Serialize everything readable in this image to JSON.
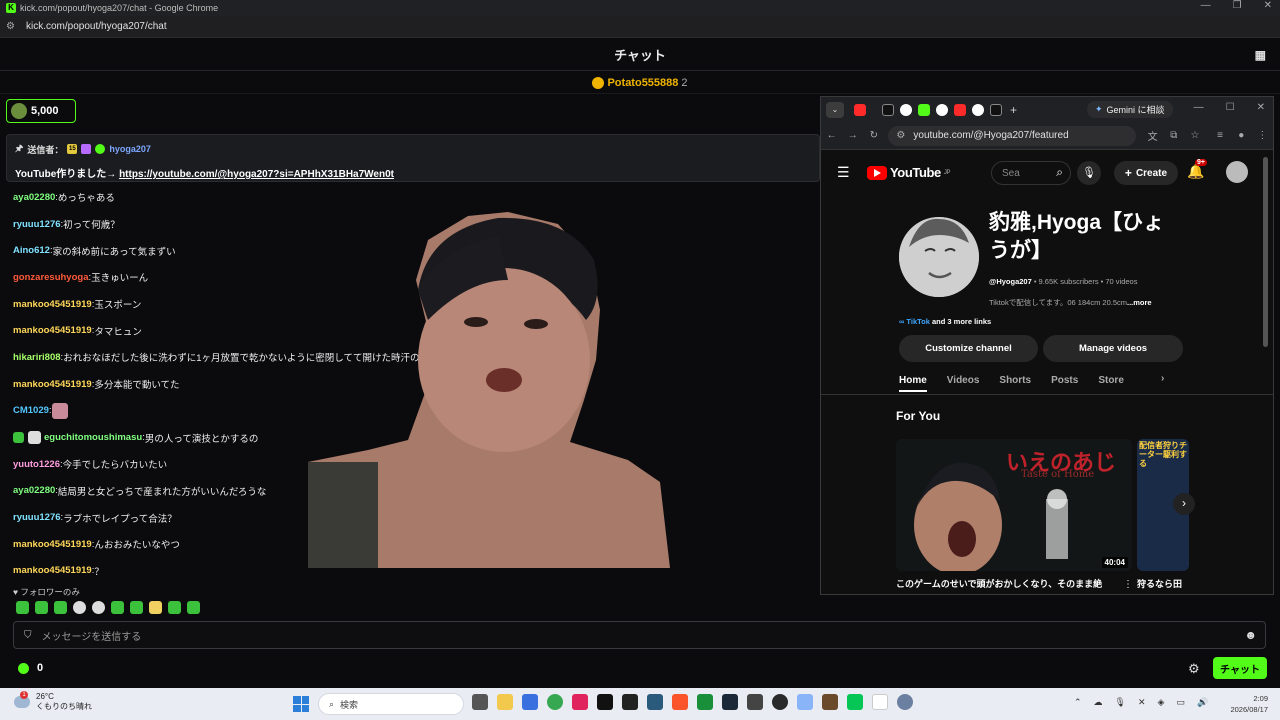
{
  "window": {
    "title": "kick.com/popout/hyoga207/chat - Google Chrome",
    "url": "kick.com/popout/hyoga207/chat"
  },
  "chat": {
    "header": "チャット",
    "gift_user": "Potato555888",
    "gift_count": "2",
    "kicks_balance": "5,000",
    "pinned": {
      "label": "送信者：",
      "badge_sub": "15",
      "user": "hyoga207",
      "message_prefix": "YouTube作りました→ ",
      "link": "https://youtube.com/@hyoga207?si=APHhX31BHa7Wen0t"
    },
    "messages": [
      {
        "user": "aya02280",
        "color": "#80ff80",
        "text": "めっちゃある"
      },
      {
        "user": "ryuuu1276",
        "color": "#7fe3ff",
        "text": "初って何歳？"
      },
      {
        "user": "Aino612",
        "color": "#7fe3ff",
        "text": "家の斜め前にあって気まずい"
      },
      {
        "user": "gonzaresuhyoga",
        "color": "#ff5a3a",
        "text": "玉きゅいーん"
      },
      {
        "user": "mankoo45451919",
        "color": "#ffd75a",
        "text": "玉スポーン"
      },
      {
        "user": "mankoo45451919",
        "color": "#ffd75a",
        "text": "タマヒュン"
      },
      {
        "user": "hikariri808",
        "color": "#a6ff6a",
        "text": "おれおなほだした後に洗わずに1ヶ月放置で乾かないように密閉してて開けた時汗の匂"
      },
      {
        "user": "mankoo45451919",
        "color": "#ffd75a",
        "text": "多分本能で動いてた"
      },
      {
        "user": "CM1029",
        "color": "#53c8ff",
        "text": "",
        "emote": "pig-emote"
      },
      {
        "user": "eguchitomoushimasu",
        "color": "#80ff80",
        "text": "男の人って演技とかするの",
        "badges": true
      },
      {
        "user": "yuuto1226",
        "color": "#ff9ee0",
        "text": "今手でしたらバカいたい"
      },
      {
        "user": "aya02280",
        "color": "#80ff80",
        "text": "結局男と女どっちで産まれた方がいいんだろうな"
      },
      {
        "user": "ryuuu1276",
        "color": "#7fe3ff",
        "text": "ラブホでレイプって合法？"
      },
      {
        "user": "mankoo45451919",
        "color": "#ffd75a",
        "text": "んおおみたいなやつ"
      },
      {
        "user": "mankoo45451919",
        "color": "#ffd75a",
        "text": "？"
      }
    ],
    "followers_only": "♥ フォロワーのみ",
    "input_placeholder": "メッセージを送信する",
    "points": "0",
    "send_label": "チャット"
  },
  "youtube_window": {
    "gemini_label": "Gemini に相談",
    "url": "youtube.com/@Hyoga207/featured",
    "logo": "YouTube",
    "logo_region": "JP",
    "search_placeholder": "Sea",
    "create_label": "Create",
    "notif_count": "9+",
    "channel_name": "豹雅,Hyoga【ひょうが】",
    "handle": "@Hyoga207",
    "stats": " • 9.65K subscribers • 70 videos",
    "description": "Tiktokで配信してます。06 184cm 20.5cm",
    "more": "...more",
    "link_main": "∞ TikTok",
    "link_more": " and 3 more links",
    "customize_label": "Customize channel",
    "manage_label": "Manage videos",
    "tabs": [
      "Home",
      "Videos",
      "Shorts",
      "Posts",
      "Store"
    ],
    "section_title": "For You",
    "video1": {
      "title": "このゲームのせいで頭がおかしくなり、そのまま絶",
      "duration": "40:04",
      "thumb_ja": "いえのあじ",
      "thumb_en": "Taste of Home"
    },
    "video2": {
      "title": "狩るなら田",
      "thumb_text": "配信者狩りチーター駆利する"
    }
  },
  "taskbar": {
    "temp": "26°C",
    "weather": "くもりのち晴れ",
    "search": "検索",
    "time": "2:09",
    "date": "2026/08/17"
  }
}
